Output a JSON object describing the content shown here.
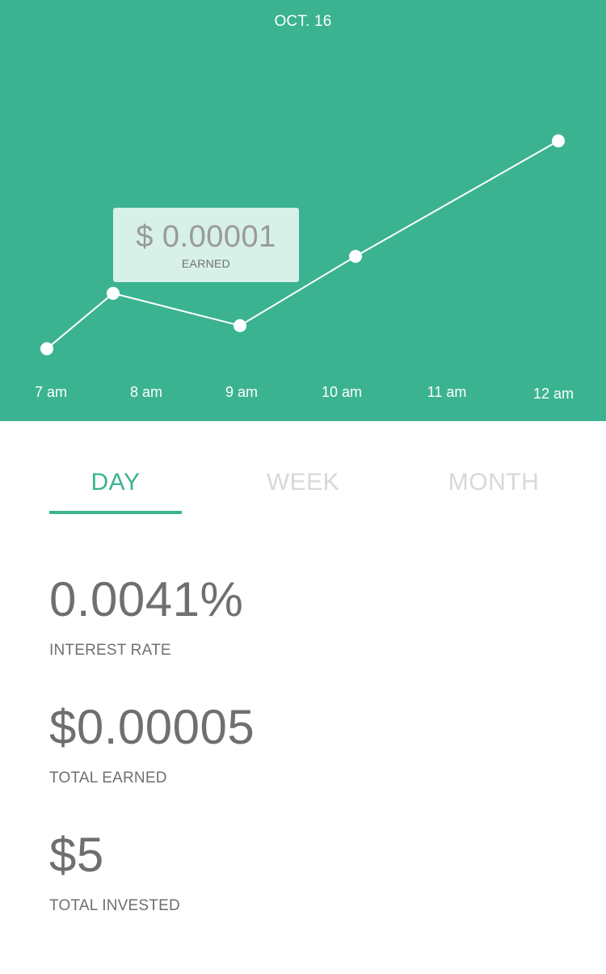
{
  "header": {
    "date": "OCT. 16"
  },
  "tooltip": {
    "amount": "$ 0.00001",
    "label": "EARNED"
  },
  "chart_data": {
    "type": "line",
    "categories": [
      "7 am",
      "8 am",
      "9 am",
      "10 am",
      "11 am",
      "12 am"
    ],
    "series": [
      {
        "values": [
          0.1,
          0.34,
          0.2,
          0.5,
          null,
          1.0
        ]
      }
    ],
    "ylim": [
      0,
      1.4
    ],
    "grid": false,
    "colors": {
      "line": "#ffffff",
      "background": "#3bb391"
    }
  },
  "tabs": [
    {
      "label": "DAY",
      "active": true
    },
    {
      "label": "WEEK",
      "active": false
    },
    {
      "label": "MONTH",
      "active": false
    }
  ],
  "stats": {
    "interest_rate": {
      "value": "0.0041%",
      "label": "INTEREST RATE"
    },
    "total_earned": {
      "value": "$0.00005",
      "label": "TOTAL EARNED"
    },
    "total_invested": {
      "value": "$5",
      "label": "TOTAL INVESTED"
    }
  },
  "colors": {
    "accent": "#3bb391",
    "tooltip_bg": "#d7f0e8",
    "inactive_tab": "#d8d8d8",
    "text": "#6f6f6f"
  }
}
